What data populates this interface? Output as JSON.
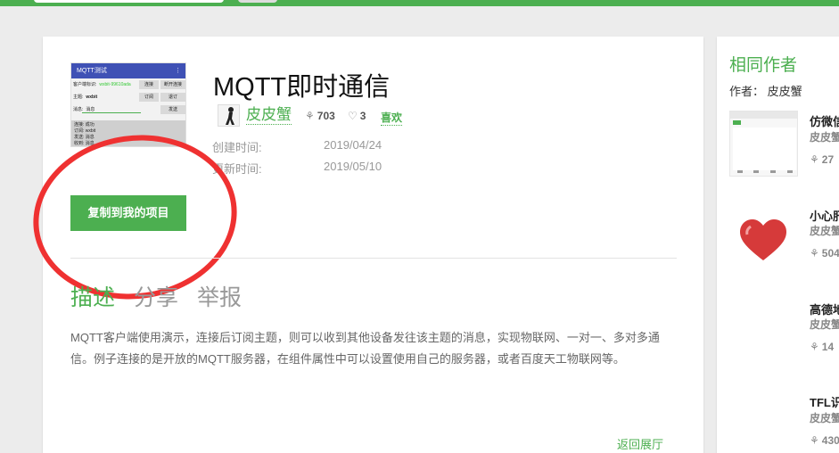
{
  "project": {
    "title": "MQTT即时通信",
    "author": "皮皮蟹",
    "views": "703",
    "likes": "3",
    "like_label": "喜欢",
    "created_label": "创建时间:",
    "created_value": "2019/04/24",
    "updated_label": "更新时间:",
    "updated_value": "2019/05/10",
    "copy_button": "复制到我的项目"
  },
  "preview": {
    "app_title": "MQTT测试",
    "menu_glyph": "⋮",
    "client_label": "客户端标识:",
    "client_value": "wxbit-99610ada",
    "connect_btn": "连接",
    "disconnect_btn": "断开连接",
    "topic_label": "主题:",
    "topic_value": "wxbit",
    "subscribe_btn": "订阅",
    "unsubscribe_btn": "退订",
    "message_label": "消息:",
    "message_value": "消息",
    "send_btn": "发送",
    "log_lines": [
      "连接: 成功",
      "订阅: wxbit",
      "发送: 消息",
      "收到: 消息"
    ]
  },
  "tabs": {
    "describe": "描述",
    "share": "分享",
    "report": "举报"
  },
  "description": "MQTT客户端使用演示，连接后订阅主题，则可以收到其他设备发往该主题的消息，实现物联网、一对一、多对多通信。例子连接的是开放的MQTT服务器，在组件属性中可以设置使用自己的服务器，或者百度天工物联网等。",
  "back_link": "返回展厅",
  "sidebar": {
    "title": "相同作者",
    "author_line": "作者： 皮皮蟹",
    "items": [
      {
        "name": "仿微信",
        "author": "皮皮蟹",
        "count": "27"
      },
      {
        "name": "小心肝",
        "author": "皮皮蟹",
        "count": "504"
      },
      {
        "name": "高德地",
        "author": "皮皮蟹",
        "count": "14"
      },
      {
        "name": "TFL识",
        "author": "皮皮蟹",
        "count": "430"
      }
    ]
  },
  "icons": {
    "views": "tree-icon",
    "likes": "heart-icon"
  },
  "colors": {
    "accent": "#4caf50",
    "annotation": "#ef3131",
    "preview_bar": "#3f51b5"
  }
}
